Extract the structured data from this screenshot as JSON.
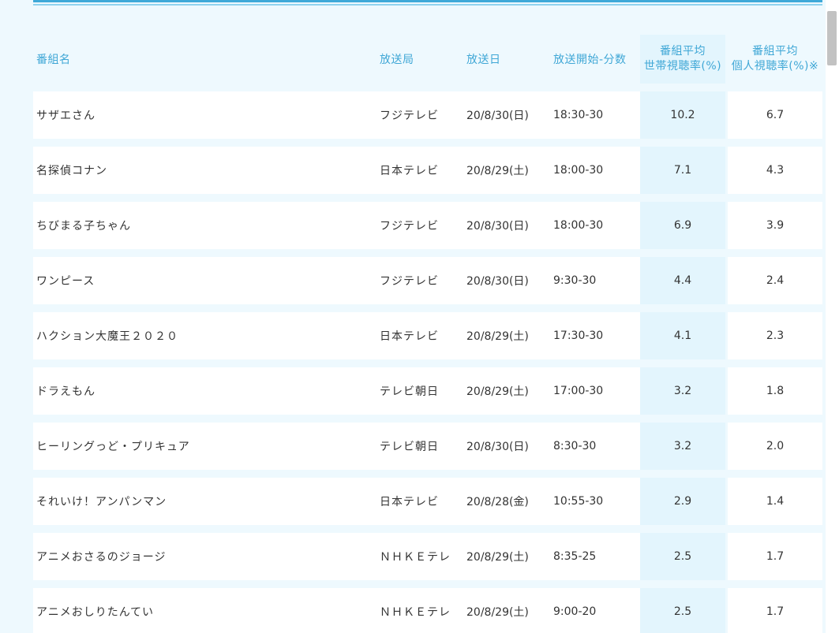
{
  "columns": {
    "title": "番組名",
    "station": "放送局",
    "date": "放送日",
    "time": "放送開始-分数",
    "household_line1": "番組平均",
    "household_line2": "世帯視聴率(%)",
    "individual_line1": "番組平均",
    "individual_line2": "個人視聴率(%)※"
  },
  "rows": [
    {
      "title": "サザエさん",
      "station": "フジテレビ",
      "date": "20/8/30(日)",
      "time": "18:30-30",
      "household": "10.2",
      "individual": "6.7"
    },
    {
      "title": "名探偵コナン",
      "station": "日本テレビ",
      "date": "20/8/29(土)",
      "time": "18:00-30",
      "household": "7.1",
      "individual": "4.3"
    },
    {
      "title": "ちびまる子ちゃん",
      "station": "フジテレビ",
      "date": "20/8/30(日)",
      "time": "18:00-30",
      "household": "6.9",
      "individual": "3.9"
    },
    {
      "title": "ワンピース",
      "station": "フジテレビ",
      "date": "20/8/30(日)",
      "time": "9:30-30",
      "household": "4.4",
      "individual": "2.4"
    },
    {
      "title": "ハクション大魔王２０２０",
      "station": "日本テレビ",
      "date": "20/8/29(土)",
      "time": "17:30-30",
      "household": "4.1",
      "individual": "2.3"
    },
    {
      "title": "ドラえもん",
      "station": "テレビ朝日",
      "date": "20/8/29(土)",
      "time": "17:00-30",
      "household": "3.2",
      "individual": "1.8"
    },
    {
      "title": "ヒーリングっど・プリキュア",
      "station": "テレビ朝日",
      "date": "20/8/30(日)",
      "time": "8:30-30",
      "household": "3.2",
      "individual": "2.0"
    },
    {
      "title": "それいけ！アンパンマン",
      "station": "日本テレビ",
      "date": "20/8/28(金)",
      "time": "10:55-30",
      "household": "2.9",
      "individual": "1.4"
    },
    {
      "title": "アニメおさるのジョージ",
      "station": "ＮＨＫＥテレ",
      "date": "20/8/29(土)",
      "time": "8:35-25",
      "household": "2.5",
      "individual": "1.7"
    },
    {
      "title": "アニメおしりたんてい",
      "station": "ＮＨＫＥテレ",
      "date": "20/8/29(土)",
      "time": "9:00-20",
      "household": "2.5",
      "individual": "1.7"
    }
  ],
  "colors": {
    "background": "#eef9fe",
    "header_text": "#3fa7d6",
    "highlight_column": "#e3f5fd",
    "rule": "#3fa9d8"
  }
}
